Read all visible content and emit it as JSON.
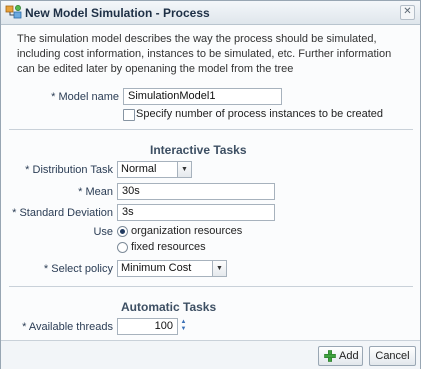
{
  "window": {
    "title": "New Model Simulation - Process",
    "close_icon": "close-icon",
    "title_icon": "process-simulation-icon"
  },
  "description": "The simulation model describes the way the process should be simulated, including cost information, instances to be simulated, etc. Further information can be edited later by openaning the model from the tree",
  "model": {
    "required_mark": "*",
    "name_label": "Model name",
    "name_value": "SimulationModel1",
    "instances_checkbox_label": "Specify number of process instances to be created",
    "instances_checked": false
  },
  "interactive": {
    "title": "Interactive Tasks",
    "distribution_label": "Distribution Task",
    "distribution_value": "Normal",
    "mean_label": "Mean",
    "mean_value": "30s",
    "std_label": "Standard Deviation",
    "std_value": "3s",
    "use_label": "Use",
    "use_options": [
      "organization resources",
      "fixed resources"
    ],
    "use_selected": "organization resources",
    "policy_label": "Select policy",
    "policy_value": "Minimum Cost"
  },
  "automatic": {
    "title": "Automatic Tasks",
    "threads_label": "Available threads",
    "threads_value": "100"
  },
  "footer": {
    "add_label": "Add",
    "add_icon": "plus-icon",
    "cancel_label": "Cancel"
  },
  "colors": {
    "label": "#2b3d55",
    "accent": "#3a6fb5",
    "add_icon": "#3fa33f"
  }
}
